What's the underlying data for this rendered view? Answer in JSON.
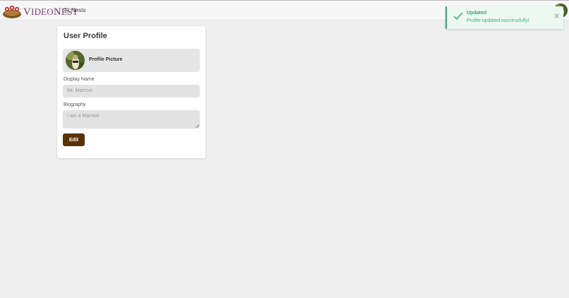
{
  "header": {
    "logo_text_first": "V",
    "logo_text_rest": "IDEO",
    "logo_text_second": "N",
    "logo_text_second_rest": "EST",
    "nav_nests_label": "Nests",
    "nav_icon": "list-icon",
    "avatar_icon": "user-avatar"
  },
  "profile": {
    "title": "User Profile",
    "picture_label": "Profile Picture",
    "display_name_label": "Display Name",
    "display_name_placeholder": "Mr. Marmot",
    "biography_label": "Biography",
    "biography_placeholder": "I am a Marmot",
    "edit_button_label": "Edit"
  },
  "toast": {
    "title": "Updated",
    "message": "Profile updated successfully!",
    "icon": "checkmark-icon",
    "close_icon": "close-icon",
    "accent_color": "#2eaa7c"
  },
  "colors": {
    "brand": "#7a3a78",
    "button": "#5a3208",
    "background": "#efefef"
  }
}
